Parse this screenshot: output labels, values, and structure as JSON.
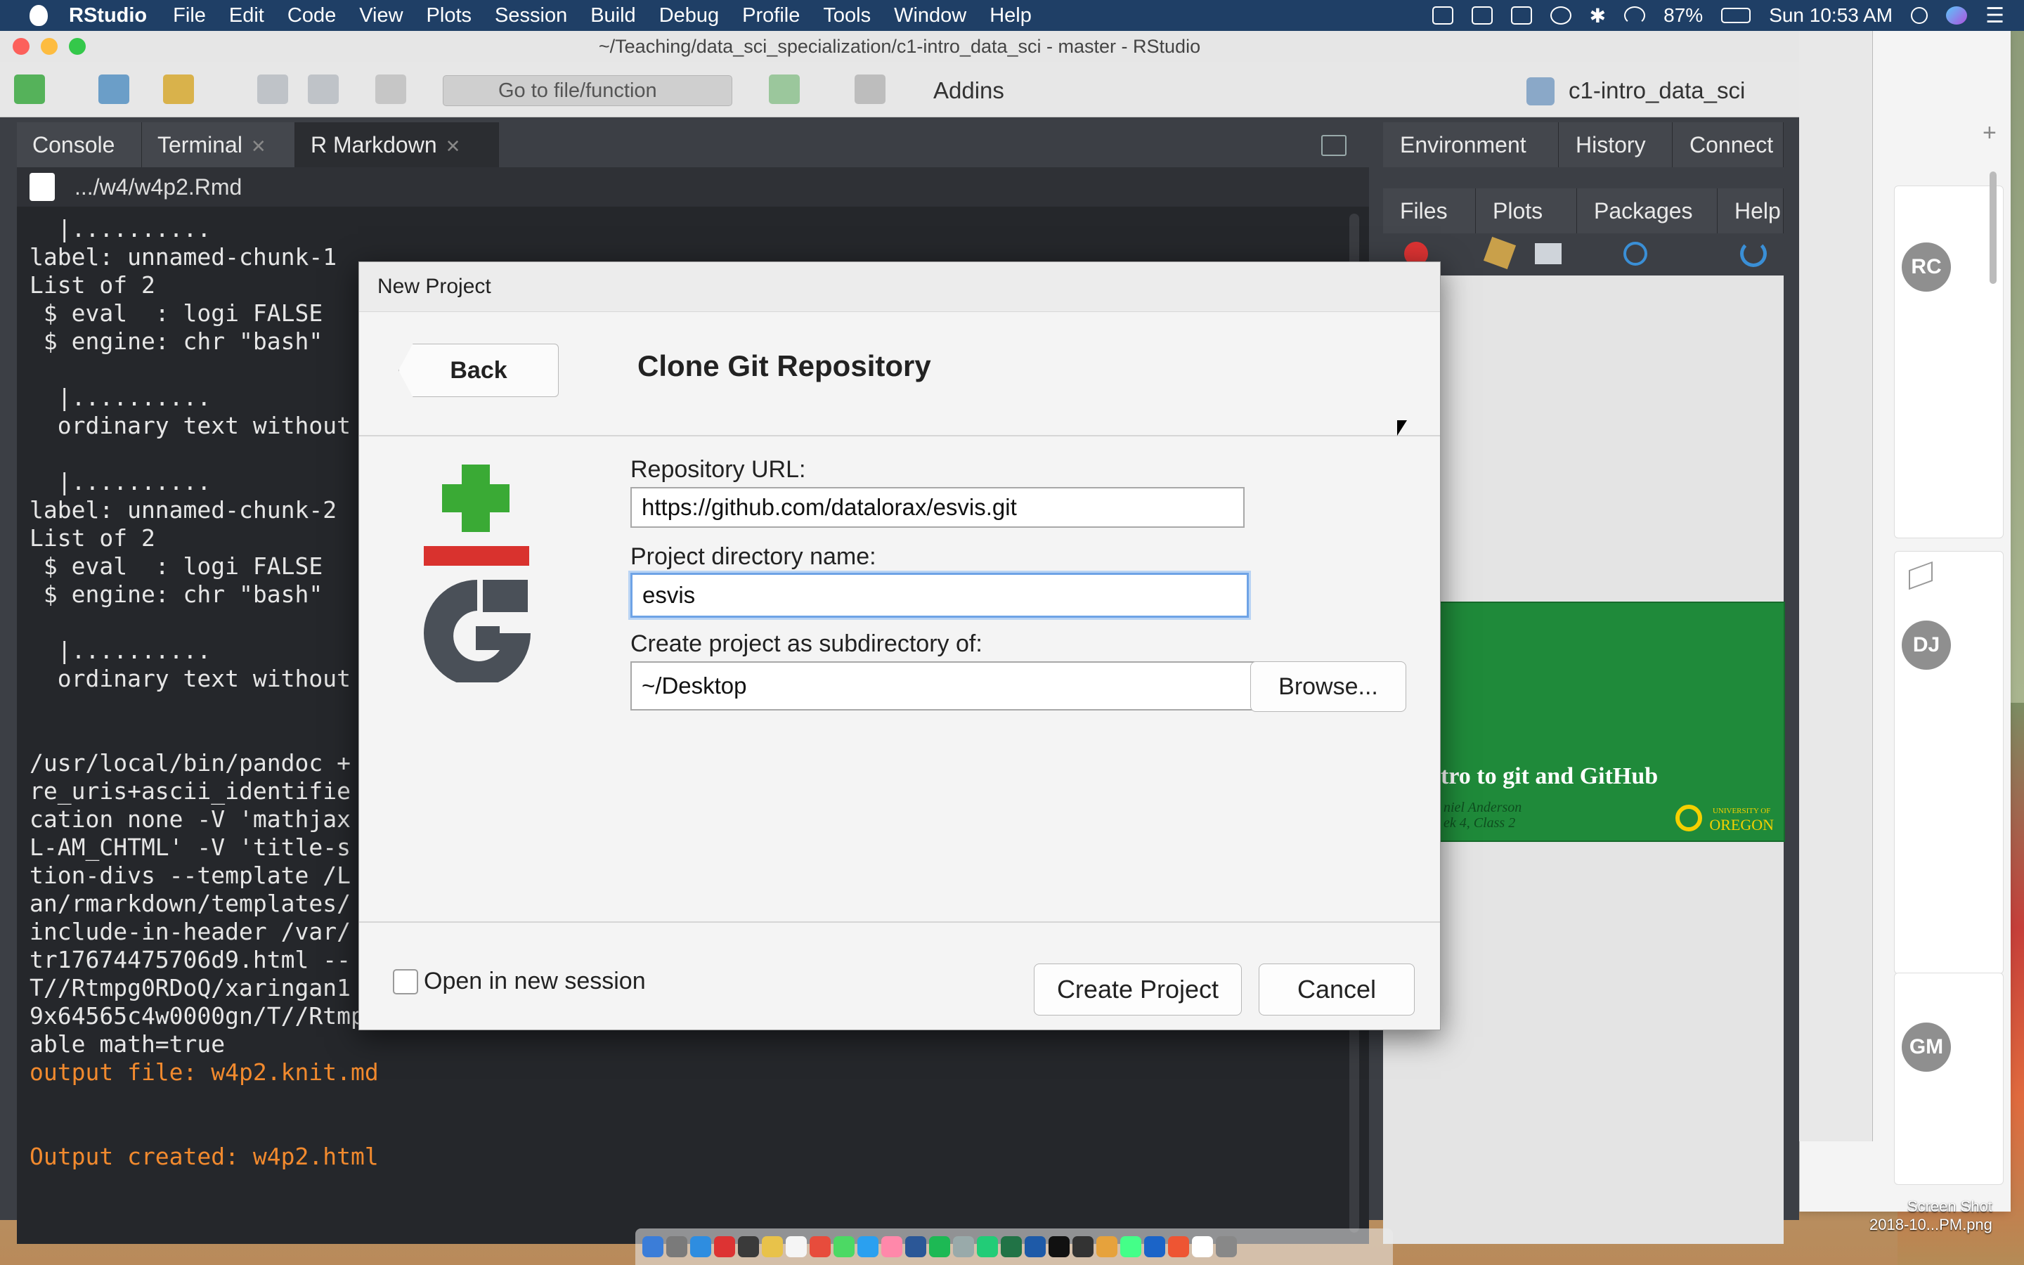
{
  "menubar": {
    "app_name": "RStudio",
    "items": [
      "File",
      "Edit",
      "Code",
      "View",
      "Plots",
      "Session",
      "Build",
      "Debug",
      "Profile",
      "Tools",
      "Window",
      "Help"
    ],
    "battery": "87%",
    "clock": "Sun 10:53 AM"
  },
  "window": {
    "title": "~/Teaching/data_sci_specialization/c1-intro_data_sci - master - RStudio"
  },
  "toolbar": {
    "goto_placeholder": "Go to file/function",
    "addins_label": "Addins",
    "project_name": "c1-intro_data_sci"
  },
  "left_pane": {
    "tabs": [
      {
        "label": "Console",
        "closable": false,
        "active": false
      },
      {
        "label": "Terminal",
        "closable": true,
        "active": false
      },
      {
        "label": "R Markdown",
        "closable": true,
        "active": true
      }
    ],
    "file_path": ".../w4/w4p2.Rmd"
  },
  "console": {
    "lines": [
      {
        "text": "  |..........",
        "color": "normal"
      },
      {
        "text": "label: unnamed-chunk-1",
        "color": "normal"
      },
      {
        "text": "List of 2",
        "color": "normal"
      },
      {
        "text": " $ eval  : logi FALSE",
        "color": "normal"
      },
      {
        "text": " $ engine: chr \"bash\"",
        "color": "normal"
      },
      {
        "text": "",
        "color": "normal"
      },
      {
        "text": "  |..........",
        "color": "normal"
      },
      {
        "text": "  ordinary text without",
        "color": "normal"
      },
      {
        "text": "",
        "color": "normal"
      },
      {
        "text": "  |..........",
        "color": "normal"
      },
      {
        "text": "label: unnamed-chunk-2",
        "color": "normal"
      },
      {
        "text": "List of 2",
        "color": "normal"
      },
      {
        "text": " $ eval  : logi FALSE",
        "color": "normal"
      },
      {
        "text": " $ engine: chr \"bash\"",
        "color": "normal"
      },
      {
        "text": "",
        "color": "normal"
      },
      {
        "text": "  |..........",
        "color": "normal"
      },
      {
        "text": "  ordinary text without",
        "color": "normal"
      },
      {
        "text": "",
        "color": "normal"
      },
      {
        "text": "",
        "color": "normal"
      },
      {
        "text": "/usr/local/bin/pandoc +",
        "color": "normal"
      },
      {
        "text": "re_uris+ascii_identifie",
        "color": "normal"
      },
      {
        "text": "cation none -V 'mathjax",
        "color": "normal"
      },
      {
        "text": "L-AM_CHTML' -V 'title-s",
        "color": "normal"
      },
      {
        "text": "tion-divs --template /L",
        "color": "normal"
      },
      {
        "text": "an/rmarkdown/templates/",
        "color": "normal"
      },
      {
        "text": "include-in-header /var/",
        "color": "normal"
      },
      {
        "text": "tr17674475706d9.html --",
        "color": "normal"
      },
      {
        "text": "T//Rtmpg0RDoQ/xaringan1",
        "color": "normal"
      },
      {
        "text": "9x64565c4w0000gn/T//Rtmpg0RDoQ/xaringan17674607cf09e.js --variable title-slide=true --vari",
        "color": "normal"
      },
      {
        "text": "able math=true",
        "color": "normal"
      },
      {
        "text": "output file: w4p2.knit.md",
        "color": "orange"
      },
      {
        "text": "",
        "color": "normal"
      },
      {
        "text": "",
        "color": "normal"
      },
      {
        "text": "Output created: w4p2.html",
        "color": "orange"
      }
    ]
  },
  "right_pane": {
    "top_tabs": [
      "Environment",
      "History",
      "Connect"
    ],
    "bottom_tabs": [
      "Files",
      "Plots",
      "Packages",
      "Help"
    ],
    "slide": {
      "title": "tro to git and GitHub",
      "subtitle_lines": [
        "niel Anderson",
        "ek 4, Class 2"
      ],
      "logo_text": [
        "UNIVERSITY OF",
        "OREGON"
      ]
    }
  },
  "dialog": {
    "title": "New Project",
    "back_label": "Back",
    "heading": "Clone Git Repository",
    "repo_url_label": "Repository URL:",
    "repo_url_value": "https://github.com/datalorax/esvis.git",
    "dir_name_label": "Project directory name:",
    "dir_name_value": "esvis",
    "subdir_label": "Create project as subdirectory of:",
    "subdir_value": "~/Desktop",
    "browse_label": "Browse...",
    "open_new_session_label": "Open in new session",
    "open_new_session_checked": false,
    "create_label": "Create Project",
    "cancel_label": "Cancel"
  },
  "background_window": {
    "avatars": [
      "RC",
      "DJ",
      "GM"
    ]
  },
  "desktop": {
    "screenshot_label": [
      "Screen Shot",
      "2018-10...PM.png"
    ]
  },
  "colors": {
    "menubar": "#1f3f66",
    "console_bg": "#25272b",
    "orange_text": "#f28a2e",
    "git_green": "#3aaa35",
    "git_red": "#d9322e",
    "git_grey": "#4a5058",
    "slide_green": "#1f8a3a",
    "focus_ring": "#6ea3e6"
  },
  "icons": {
    "git_logo": "git-plus-logo",
    "checkbox": "unchecked"
  }
}
